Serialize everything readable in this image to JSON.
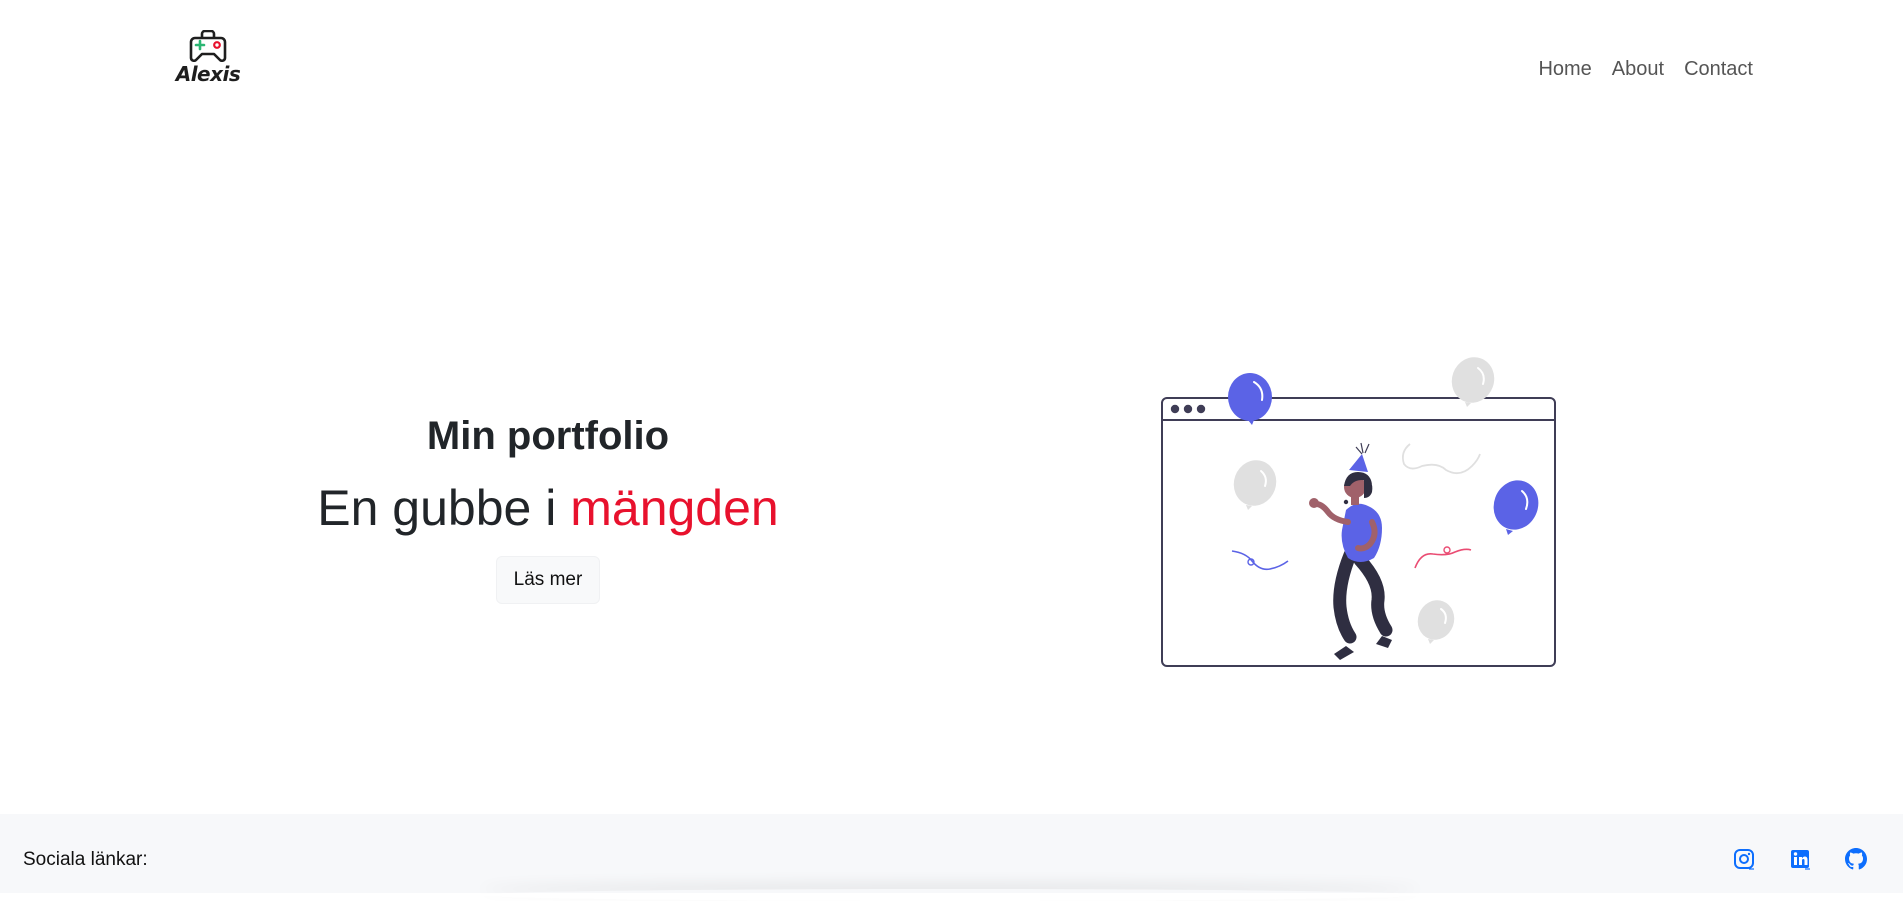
{
  "header": {
    "logo_text": "Alexis",
    "nav": [
      "Home",
      "About",
      "Contact"
    ]
  },
  "hero": {
    "title": "Min portfolio",
    "subtitle_prefix": "En gubbe i ",
    "subtitle_accent": "mängden",
    "button_label": "Läs mer",
    "accent_color": "#e8112d"
  },
  "illustration": {
    "name": "party-celebration-illustration",
    "primary_color": "#5b63e6"
  },
  "footer": {
    "label": "Sociala länkar:",
    "links": [
      "instagram-icon",
      "linkedin-icon",
      "github-icon"
    ],
    "link_color": "#0d6efd"
  }
}
